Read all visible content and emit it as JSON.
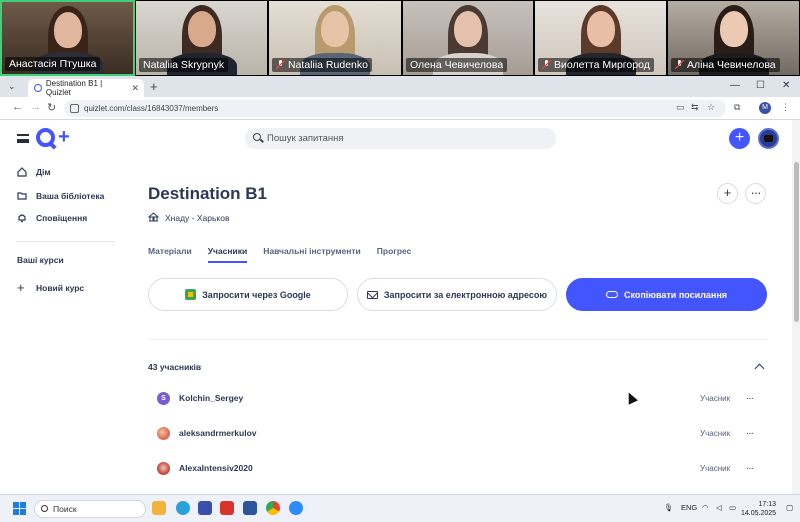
{
  "video_call": {
    "participants": [
      {
        "name": "Анастасія Птушка",
        "muted": false,
        "active": true
      },
      {
        "name": "Nataliia Skrypnyk",
        "muted": false,
        "active": false
      },
      {
        "name": "Nataliia Rudenko",
        "muted": true,
        "active": false
      },
      {
        "name": "Олена Чевичелова",
        "muted": false,
        "active": false
      },
      {
        "name": "Виолетта Миргород",
        "muted": true,
        "active": false
      },
      {
        "name": "Аліна  Чевичелова",
        "muted": true,
        "active": false
      }
    ]
  },
  "browser": {
    "tab_title": "Destination B1 | Quizlet",
    "url": "quizlet.com/class/16843037/members",
    "profile_initial": "M"
  },
  "header": {
    "search_placeholder": "Пошук запитання"
  },
  "sidebar": {
    "items": [
      {
        "label": "Дім",
        "icon": "home-icon"
      },
      {
        "label": "Ваша бібліотека",
        "icon": "folder-icon"
      },
      {
        "label": "Сповіщення",
        "icon": "bell-icon"
      }
    ],
    "courses_heading": "Ваші курси",
    "new_course_label": "Новий курс"
  },
  "class": {
    "title": "Destination B1",
    "school": "Хнаду - Харьков",
    "tabs": [
      {
        "label": "Матеріали",
        "active": false
      },
      {
        "label": "Учасники",
        "active": true
      },
      {
        "label": "Навчальні інструменти",
        "active": false
      },
      {
        "label": "Прогрес",
        "active": false
      }
    ],
    "actions": {
      "invite_google": "Запросити через Google",
      "invite_email": "Запросити за електронною адресою",
      "copy_link": "Скопіювати посилання"
    },
    "members_count": "43 учасників",
    "members": [
      {
        "name": "Kolchin_Sergey",
        "role": "Учасник",
        "initial": "S",
        "color": "#7b5bd6"
      },
      {
        "name": "aleksandrmerkulov",
        "role": "Учасник",
        "initial": "",
        "color": "#e06a4f"
      },
      {
        "name": "AlexaIntensiv2020",
        "role": "Учасник",
        "initial": "",
        "color": "#c4433a"
      }
    ]
  },
  "taskbar": {
    "search_label": "Поиск",
    "language": "ENG",
    "time": "17:13",
    "date": "14.05.2025"
  },
  "colors": {
    "accent": "#4255ff",
    "text_primary": "#2e3856",
    "text_secondary": "#586380",
    "active_speaker": "#3fd07a"
  }
}
